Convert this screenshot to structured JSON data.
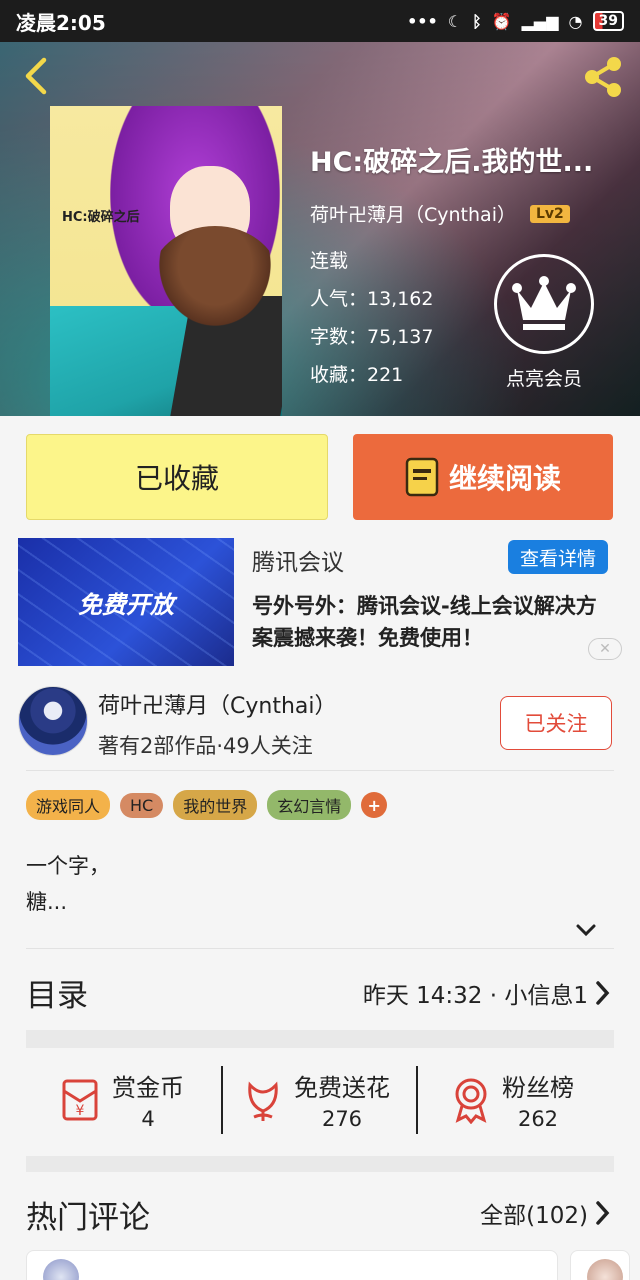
{
  "status_bar": {
    "time": "凌晨2:05",
    "battery": "39"
  },
  "book": {
    "title": "HC:破碎之后.我的世...",
    "cover_text": "HC:破碎之后",
    "author": "荷叶卍薄月（Cynthai）",
    "level": "Lv2",
    "status": "连载",
    "popularity": "人气：13,162",
    "word_count": "字数：75,137",
    "favorites": "收藏：221",
    "vip_label": "点亮会员"
  },
  "actions": {
    "favorited": "已收藏",
    "continue_reading": "继续阅读"
  },
  "ad": {
    "image_text": "免费开放",
    "title": "腾讯会议",
    "more": "查看详情",
    "description": "号外号外：腾讯会议-线上会议解决方案震撼来袭！免费使用！",
    "close": "✕"
  },
  "author_info": {
    "name": "荷叶卍薄月（Cynthai）",
    "meta": "著有2部作品·49人关注",
    "follow": "已关注"
  },
  "tags": [
    {
      "label": "游戏同人",
      "color": "#f3b24a"
    },
    {
      "label": "HC",
      "color": "#d58a63"
    },
    {
      "label": "我的世界",
      "color": "#d6a748"
    },
    {
      "label": "玄幻言情",
      "color": "#93b86a"
    }
  ],
  "tag_more": "+",
  "description": {
    "line1": "一个字，",
    "line2": "糖..."
  },
  "catalog": {
    "title": "目录",
    "meta": "昨天 14:32 · 小信息1"
  },
  "stats": [
    {
      "label": "赏金币",
      "value": "4",
      "icon": "red-envelope-icon"
    },
    {
      "label": "免费送花",
      "value": "276",
      "icon": "flower-icon"
    },
    {
      "label": "粉丝榜",
      "value": "262",
      "icon": "medal-icon"
    }
  ],
  "comments": {
    "title": "热门评论",
    "all": "全部(102)"
  },
  "colors": {
    "accent": "#ec6a3d",
    "favorite": "#fcf58a",
    "follow": "#e24b3a",
    "link": "#1a7fe0",
    "icon_red": "#d9433a"
  }
}
